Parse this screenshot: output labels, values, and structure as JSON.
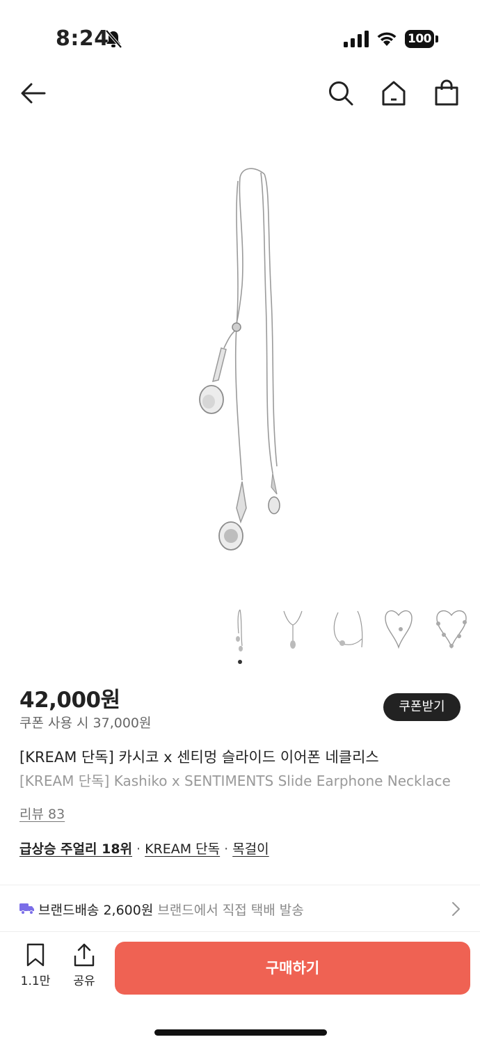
{
  "status_bar": {
    "time": "8:24",
    "battery": "100",
    "icons": [
      "bell-slash-icon",
      "signal-icon",
      "wifi-icon",
      "battery-icon"
    ]
  },
  "nav": {
    "icons": [
      "back-arrow-icon",
      "search-icon",
      "home-icon",
      "shopping-bag-icon"
    ]
  },
  "product": {
    "image_alt": "silver earphone necklace",
    "thumbnail_count": 5,
    "selected_thumbnail": 1,
    "price": "42,000원",
    "coupon_price": "쿠폰 사용 시 37,000원",
    "coupon_button": "쿠폰받기",
    "title_ko": "[KREAM 단독] 카시코 x 센티멍 슬라이드 이어폰 네클리스",
    "title_en": "[KREAM 단독] Kashiko x SENTIMENTS Slide Earphone Necklace",
    "review": "리뷰 83",
    "tags": [
      "급상승 주얼리 18위",
      "KREAM 단독",
      "목걸이"
    ],
    "tag_separator": "·"
  },
  "shipping": {
    "label": "브랜드배송 2,600원",
    "desc": "브랜드에서 직접 택배 발송"
  },
  "bottom_bar": {
    "bookmark_count": "1.1만",
    "share_label": "공유",
    "buy_label": "구매하기"
  },
  "colors": {
    "accent": "#ef6253",
    "text": "#222222",
    "subtext": "#888888",
    "truck": "#7b6ee8"
  }
}
